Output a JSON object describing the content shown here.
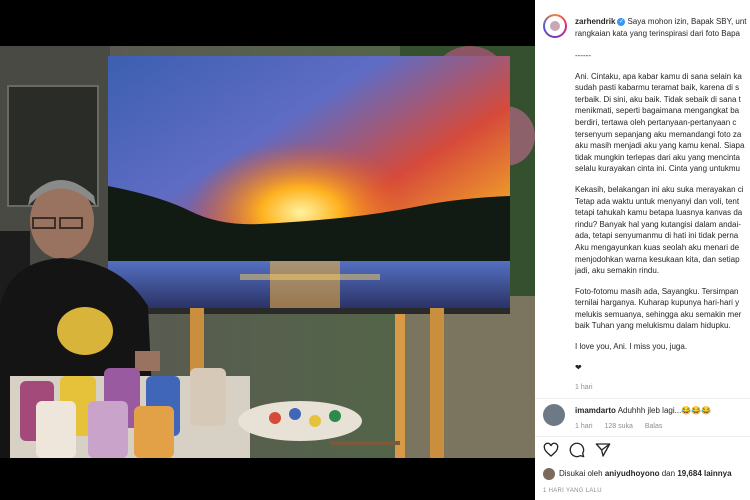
{
  "post": {
    "image_alt": "",
    "author": "zarhendrik",
    "caption_head": "Saya mohon izin, Bapak SBY, unt",
    "caption_head_2": "rangkaian kata yang terinspirasi dari foto Bapa",
    "separator": "------",
    "paragraph_1": [
      "Ani. Cintaku, apa kabar kamu di sana selain ka",
      "sudah pasti kabarmu teramat baik, karena di s",
      "terbaik. Di sini, aku baik. Tidak sebaik di sana t",
      "menikmati, seperti bagaimana mengangkat ba",
      "berdiri, tertawa oleh pertanyaan-pertanyaan c",
      "tersenyum sepanjang aku memandangi foto za",
      "aku masih menjadi aku yang kamu kenal. Siapa",
      "tidak mungkin terlepas dari aku yang mencinta",
      "selalu kurayakan cinta ini. Cinta yang untukmu"
    ],
    "paragraph_2": [
      "Kekasih, belakangan ini aku suka merayakan ci",
      "Tetap ada waktu untuk menyanyi dan voli, tent",
      "tetapi tahukah kamu betapa luasnya kanvas da",
      "rindu? Banyak hal yang kutangisi dalam andai-",
      "ada, tetapi senyumanmu di hati ini tidak perna",
      "Aku mengayunkan kuas seolah aku menari de",
      "menjodohkan warna kesukaan kita, dan setiap",
      "jadi, aku semakin rindu."
    ],
    "paragraph_3": [
      "Foto-fotomu masih ada, Sayangku. Tersimpan",
      "ternilai harganya. Kuharap kupunya hari-hari y",
      "melukis semuanya, sehingga aku semakin mer",
      "baik Tuhan yang melukismu dalam hidupku."
    ],
    "closing": "I love you, Ani. I miss you, juga.",
    "heart": "❤",
    "caption_age": "1 hari"
  },
  "comment": {
    "author": "imamdarto",
    "text": "Aduhhh jleb lagi...😂😂😂",
    "age": "1 hari",
    "likes": "128 suka",
    "reply": "Balas"
  },
  "actions": {
    "like_icon": "heart-icon",
    "comment_icon": "comment-icon",
    "share_icon": "share-icon"
  },
  "liked_by": {
    "prefix": "Disukai oleh",
    "user": "aniyudhoyono",
    "conjunction": "dan",
    "others": "19,684 lainnya"
  },
  "timestamp": "1 HARI YANG LALU",
  "colors": {
    "verified": "#3897f0",
    "text": "#262626",
    "muted": "#8e8e8e"
  }
}
